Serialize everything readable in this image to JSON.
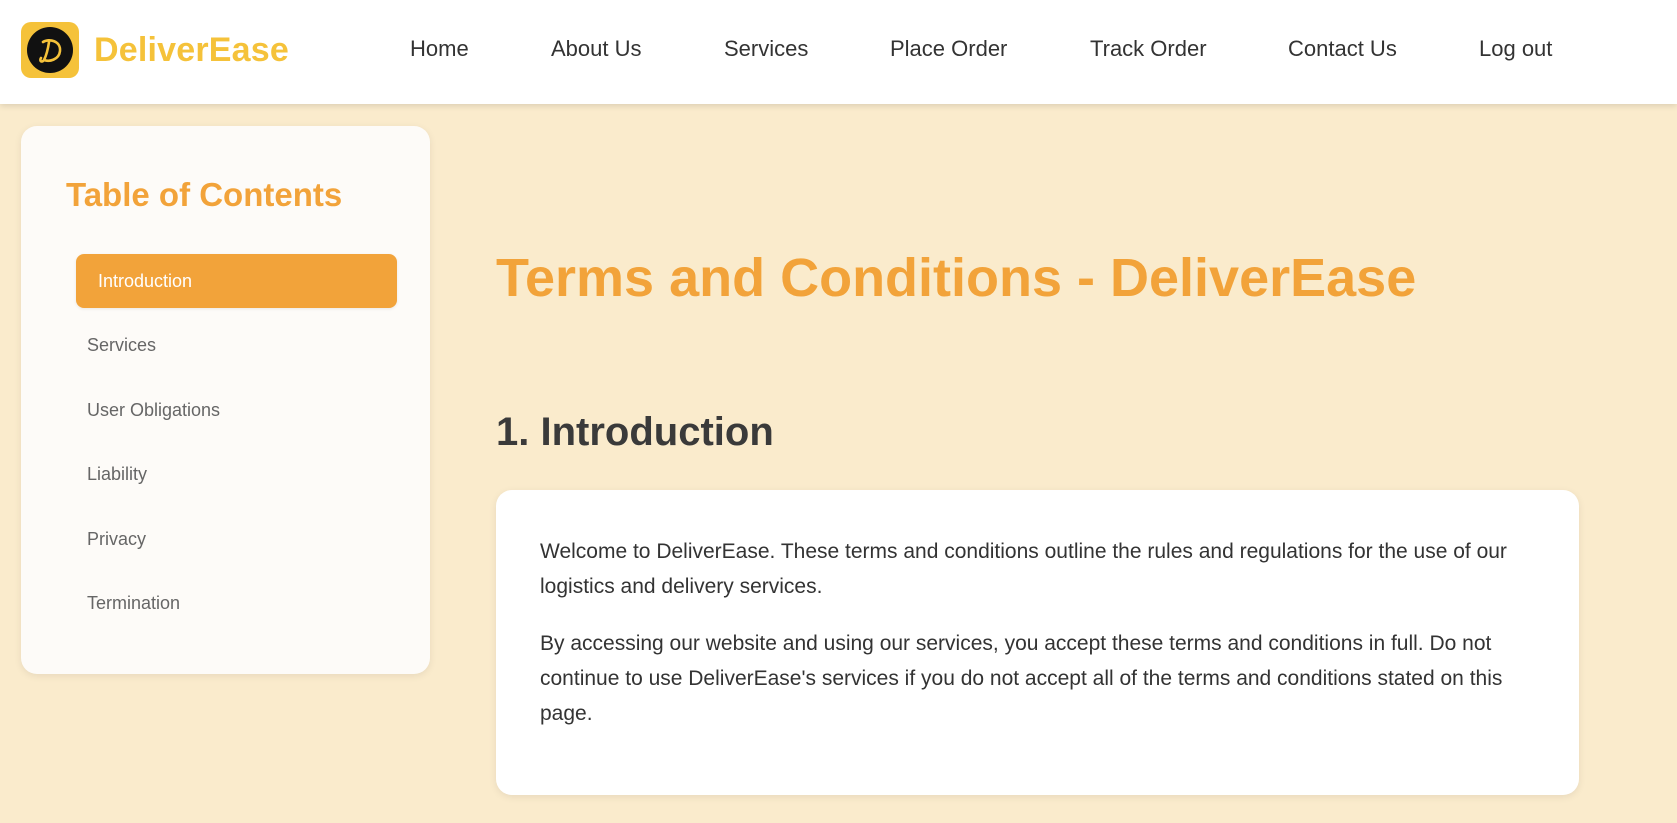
{
  "brand": {
    "name": "DeliverEase",
    "logo_letter": "D"
  },
  "nav": {
    "home": "Home",
    "about": "About Us",
    "services": "Services",
    "place_order": "Place Order",
    "track_order": "Track Order",
    "contact": "Contact Us",
    "logout": "Log out"
  },
  "toc": {
    "title": "Table of Contents",
    "items": [
      "Introduction",
      "Services",
      "User Obligations",
      "Liability",
      "Privacy",
      "Termination"
    ],
    "active_index": 0
  },
  "main": {
    "title": "Terms and Conditions - DeliverEase",
    "section_heading": "1. Introduction",
    "paragraphs": [
      "Welcome to DeliverEase. These terms and conditions outline the rules and regulations for the use of our logistics and delivery services.",
      "By accessing our website and using our services, you accept these terms and conditions in full. Do not continue to use DeliverEase's services if you do not accept all of the terms and conditions stated on this page."
    ]
  },
  "colors": {
    "accent": "#f2a33a",
    "brand_yellow": "#f5c23a",
    "background": "#faebcc"
  }
}
